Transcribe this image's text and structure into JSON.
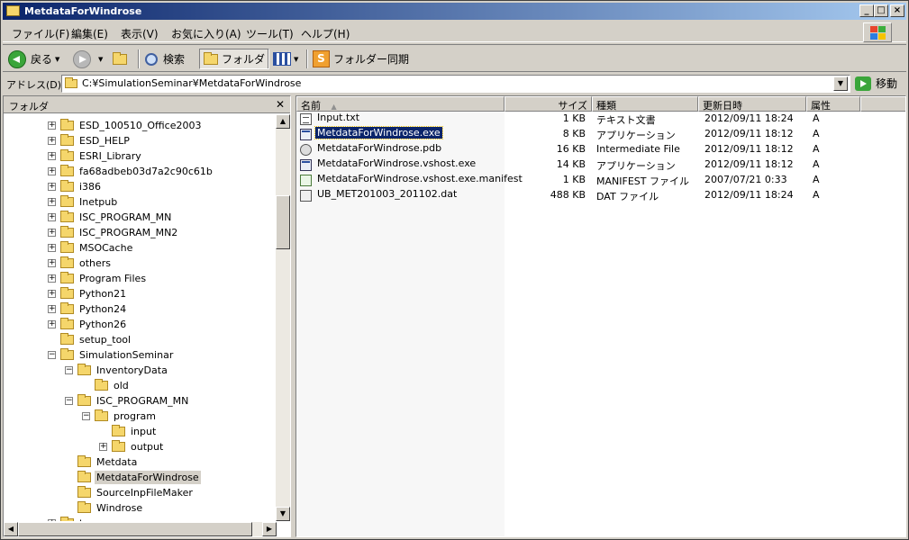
{
  "window": {
    "title": "MetdataForWindrose"
  },
  "menu": [
    "ファイル(F)",
    "編集(E)",
    "表示(V)",
    "お気に入り(A)",
    "ツール(T)",
    "ヘルプ(H)"
  ],
  "toolbar": {
    "back": "戻る",
    "search": "検索",
    "folders": "フォルダ",
    "sync": "フォルダー同期"
  },
  "address": {
    "label": "アドレス(D)",
    "value": "C:¥SimulationSeminar¥MetdataForWindrose",
    "go": "移動"
  },
  "folder_pane": {
    "title": "フォルダ",
    "tree": [
      {
        "label": "ESD_100510_Office2003",
        "depth": 0,
        "expander": "+"
      },
      {
        "label": "ESD_HELP",
        "depth": 0,
        "expander": "+"
      },
      {
        "label": "ESRI_Library",
        "depth": 0,
        "expander": "+"
      },
      {
        "label": "fa68adbeb03d7a2c90c61b",
        "depth": 0,
        "expander": "+"
      },
      {
        "label": "i386",
        "depth": 0,
        "expander": "+"
      },
      {
        "label": "Inetpub",
        "depth": 0,
        "expander": "+"
      },
      {
        "label": "ISC_PROGRAM_MN",
        "depth": 0,
        "expander": "+"
      },
      {
        "label": "ISC_PROGRAM_MN2",
        "depth": 0,
        "expander": "+"
      },
      {
        "label": "MSOCache",
        "depth": 0,
        "expander": "+"
      },
      {
        "label": "others",
        "depth": 0,
        "expander": "+"
      },
      {
        "label": "Program Files",
        "depth": 0,
        "expander": "+"
      },
      {
        "label": "Python21",
        "depth": 0,
        "expander": "+"
      },
      {
        "label": "Python24",
        "depth": 0,
        "expander": "+"
      },
      {
        "label": "Python26",
        "depth": 0,
        "expander": "+"
      },
      {
        "label": "setup_tool",
        "depth": 0,
        "expander": ""
      },
      {
        "label": "SimulationSeminar",
        "depth": 0,
        "expander": "−"
      },
      {
        "label": "InventoryData",
        "depth": 1,
        "expander": "−"
      },
      {
        "label": "old",
        "depth": 2,
        "expander": ""
      },
      {
        "label": "ISC_PROGRAM_MN",
        "depth": 1,
        "expander": "−"
      },
      {
        "label": "program",
        "depth": 2,
        "expander": "−"
      },
      {
        "label": "input",
        "depth": 3,
        "expander": ""
      },
      {
        "label": "output",
        "depth": 3,
        "expander": "+"
      },
      {
        "label": "Metdata",
        "depth": 1,
        "expander": ""
      },
      {
        "label": "MetdataForWindrose",
        "depth": 1,
        "expander": "",
        "selected": true
      },
      {
        "label": "SourceInpFileMaker",
        "depth": 1,
        "expander": ""
      },
      {
        "label": "Windrose",
        "depth": 1,
        "expander": ""
      },
      {
        "label": "temp",
        "depth": 0,
        "expander": "+"
      }
    ]
  },
  "file_list": {
    "columns": [
      "名前",
      "サイズ",
      "種類",
      "更新日時",
      "属性"
    ],
    "files": [
      {
        "name": "Input.txt",
        "size": "1 KB",
        "type": "テキスト文書",
        "modified": "2012/09/11 18:24",
        "attr": "A",
        "icon": "txt-icon"
      },
      {
        "name": "MetdataForWindrose.exe",
        "size": "8 KB",
        "type": "アプリケーション",
        "modified": "2012/09/11 18:12",
        "attr": "A",
        "icon": "exe-icon",
        "selected": true
      },
      {
        "name": "MetdataForWindrose.pdb",
        "size": "16 KB",
        "type": "Intermediate File",
        "modified": "2012/09/11 18:12",
        "attr": "A",
        "icon": "pdb-icon"
      },
      {
        "name": "MetdataForWindrose.vshost.exe",
        "size": "14 KB",
        "type": "アプリケーション",
        "modified": "2012/09/11 18:12",
        "attr": "A",
        "icon": "exe-icon"
      },
      {
        "name": "MetdataForWindrose.vshost.exe.manifest",
        "size": "1 KB",
        "type": "MANIFEST ファイル",
        "modified": "2007/07/21 0:33",
        "attr": "A",
        "icon": "manifest-icon"
      },
      {
        "name": "UB_MET201003_201102.dat",
        "size": "488 KB",
        "type": "DAT ファイル",
        "modified": "2012/09/11 18:24",
        "attr": "A",
        "icon": "dat-icon"
      }
    ]
  },
  "colors": {
    "title_start": "#0a246a",
    "title_end": "#a6caf0",
    "selection": "#0a246a",
    "folder": "#f5d66b"
  }
}
